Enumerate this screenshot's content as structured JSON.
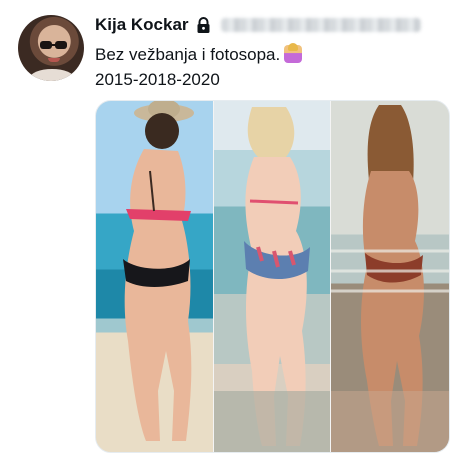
{
  "author": {
    "display_name": "Kija Kockar",
    "protected": true,
    "handle": "(blurred)"
  },
  "tweet": {
    "line1": "Bez vežbanja i fotosopa.",
    "line2": "2015-2018-2020",
    "emoji": "woman-emoji"
  },
  "media": {
    "photos": [
      {
        "label": "photo-2015"
      },
      {
        "label": "photo-2018"
      },
      {
        "label": "photo-2020"
      }
    ]
  },
  "colors": {
    "text": "#0f1419",
    "border": "#e6ecf0"
  }
}
